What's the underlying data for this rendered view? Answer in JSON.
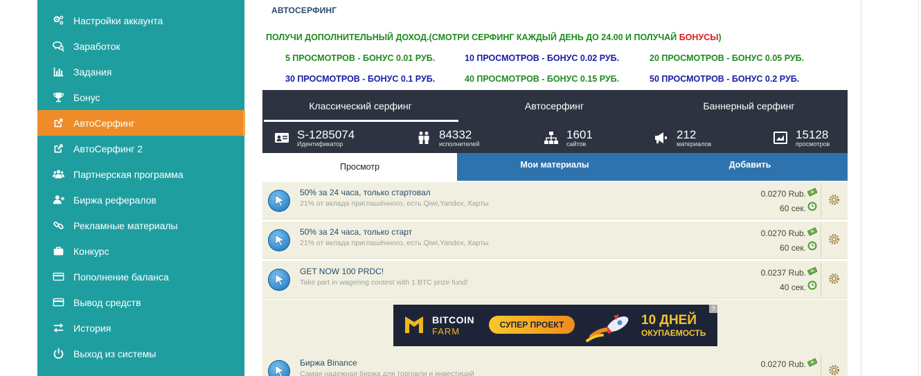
{
  "sidebar": {
    "items": [
      {
        "label": "Настройки аккаунта",
        "icon": "cogs-icon"
      },
      {
        "label": "Заработок",
        "icon": "chat-icon"
      },
      {
        "label": "Задания",
        "icon": "bar-chart-icon"
      },
      {
        "label": "Бонус",
        "icon": "trophy-icon"
      },
      {
        "label": "АвтоСерфинг",
        "icon": "external-link-icon",
        "active": true
      },
      {
        "label": "АвтоСерфинг 2",
        "icon": "external-link-icon"
      },
      {
        "label": "Партнерская программа",
        "icon": "users-icon"
      },
      {
        "label": "Биржа рефералов",
        "icon": "user-plus-icon"
      },
      {
        "label": "Рекламные материалы",
        "icon": "link-icon"
      },
      {
        "label": "Конкурс",
        "icon": "briefcase-icon"
      },
      {
        "label": "Пополнение баланса",
        "icon": "credit-card-icon"
      },
      {
        "label": "Вывод средств",
        "icon": "credit-card-icon"
      },
      {
        "label": "История",
        "icon": "exchange-icon"
      },
      {
        "label": "Выход из системы",
        "icon": "power-icon"
      }
    ],
    "active_color": "#f08c27",
    "bg_color": "#1f9ea0"
  },
  "page": {
    "title": "АВТОСЕРФИНГ",
    "promo_part1": "ПОЛУЧИ ДОПОЛНИТЕЛЬНЫЙ ДОХОД.",
    "promo_part2": "(СМОТРИ СЕРФИНГ КАЖДЫЙ ДЕНЬ ДО 24.00 И ПОЛУЧАЙ ",
    "promo_part3": "БОНУСЫ",
    "promo_part4": ")",
    "bonuses": [
      "5 ПРОСМОТРОВ - БОНУС 0.01 РУБ.",
      "10 ПРОСМОТРОВ - БОНУС 0.02 РУБ.",
      "20 ПРОСМОТРОВ - БОНУС 0.05 РУБ.",
      "30 ПРОСМОТРОВ - БОНУС 0.1 РУБ.",
      "40 ПРОСМОТРОВ - БОНУС 0.15 РУБ.",
      "50 ПРОСМОТРОВ - БОНУС 0.2 РУБ."
    ]
  },
  "surf_tabs": [
    "Классический серфинг",
    "Автосерфинг",
    "Баннерный серфинг"
  ],
  "stats": [
    {
      "value": "S-1285074",
      "label": "Идентификатор",
      "icon": "id-card-icon"
    },
    {
      "value": "84332",
      "label": "исполнителей",
      "icon": "people-icon"
    },
    {
      "value": "1601",
      "label": "сайтов",
      "icon": "sitemap-icon"
    },
    {
      "value": "212",
      "label": "материалов",
      "icon": "megaphone-icon"
    },
    {
      "value": "15128",
      "label": "просмотров",
      "icon": "chart-area-icon"
    }
  ],
  "view_tabs": [
    "Просмотр",
    "Мои материалы",
    "Добавить"
  ],
  "rows": [
    {
      "title": "50% за 24 часа, только стартовал",
      "desc": "21% от вклада приглашённого, есть Qiwi,Yandex, Карты",
      "price": "0.0270 Rub.",
      "time": "60 сек."
    },
    {
      "title": "50% за 24 часа, только старт",
      "desc": "21% от вклада приглашённого, есть Qiwi,Yandex, Карты",
      "price": "0.0270 Rub.",
      "time": "60 сек."
    },
    {
      "title": "GET NOW 100 PRDC!",
      "desc": "Take part in wagering contest with 1 BTC prize fund!",
      "price": "0.0237 Rub.",
      "time": "40 сек."
    },
    {
      "title": "Биржа Binance",
      "desc": "Самая надежная биржа для торговли и инвестиций",
      "price": "0.0270 Rub.",
      "time": ""
    }
  ],
  "banner": {
    "name1": "BITCOIN",
    "name2": "FARM",
    "button": "СУПЕР ПРОЕКТ",
    "days": "10 ДНЕЙ",
    "payback": "ОКУПАЕМОСТЬ",
    "help": "?"
  }
}
